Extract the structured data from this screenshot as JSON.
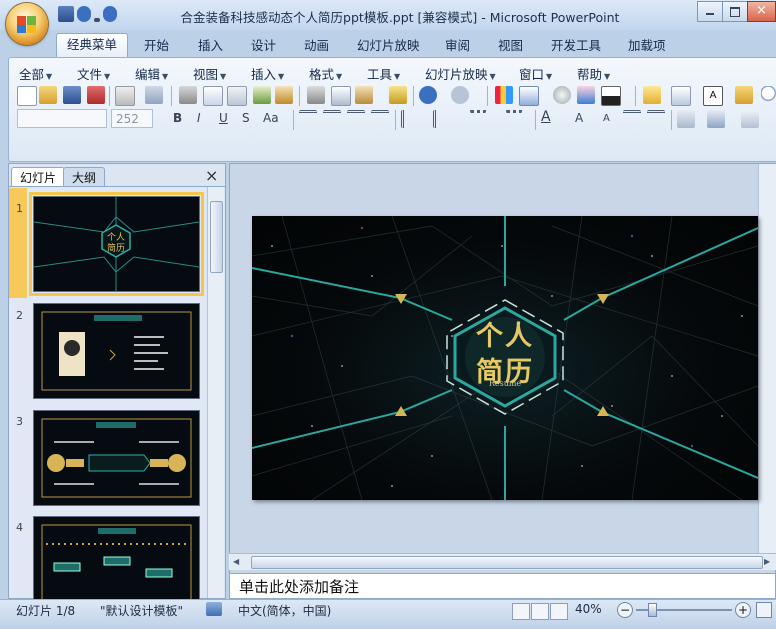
{
  "window": {
    "title": "合金装备科技感动态个人简历ppt模板.ppt [兼容模式] - Microsoft PowerPoint"
  },
  "ribbon_tabs": [
    "经典菜单",
    "开始",
    "插入",
    "设计",
    "动画",
    "幻灯片放映",
    "审阅",
    "视图",
    "开发工具",
    "加载项"
  ],
  "classic_menus": [
    "全部",
    "文件",
    "编辑",
    "视图",
    "插入",
    "格式",
    "工具",
    "幻灯片放映",
    "窗口",
    "帮助"
  ],
  "font": {
    "size_value": "252"
  },
  "pane": {
    "tabs": [
      "幻灯片",
      "大纲"
    ],
    "close": "×",
    "slide_numbers": [
      "1",
      "2",
      "3",
      "4"
    ]
  },
  "slide": {
    "title_line1": "个人",
    "title_line2": "简历",
    "subtitle": "Resume"
  },
  "notes": {
    "placeholder": "单击此处添加备注"
  },
  "status": {
    "slide_info": "幻灯片 1/8",
    "theme": "\"默认设计模板\"",
    "language": "中文(简体，中国)",
    "zoom": "40%",
    "zoom_minus": "−",
    "zoom_plus": "+"
  },
  "colors": {
    "accent": "#f6c64b",
    "slide_teal": "#2aa79f",
    "slide_gold": "#d7b557"
  }
}
